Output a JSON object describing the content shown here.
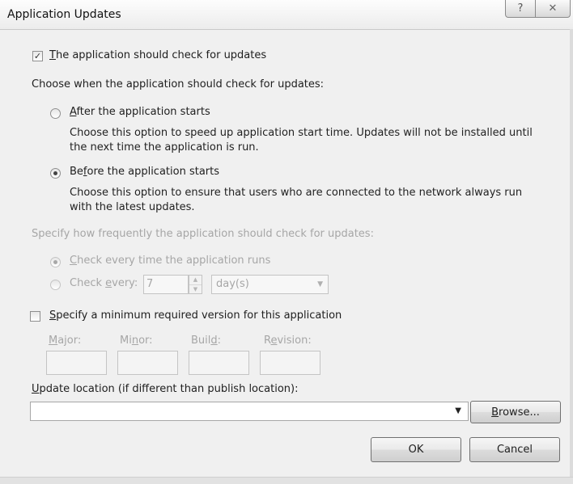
{
  "window": {
    "title": "Application Updates",
    "help_glyph": "?",
    "close_glyph": "✕"
  },
  "check_updates": {
    "checked": true,
    "check_glyph": "✓",
    "label_key": "T",
    "label_rest": "he application should check for updates"
  },
  "when": {
    "heading": "Choose when the application should check for updates:",
    "after": {
      "selected": false,
      "label_key": "A",
      "label_rest": "fter the application starts",
      "desc_line1": "Choose this option to speed up application start time. Updates will not be installed until",
      "desc_line2": "the next time the application is run."
    },
    "before": {
      "selected": true,
      "label_pre": "Be",
      "label_key": "f",
      "label_rest": "ore the application starts",
      "desc_line1": "Choose this option to ensure that users who are connected to the network always run",
      "desc_line2": "with the latest updates."
    }
  },
  "frequency": {
    "heading": "Specify how frequently the application should check for updates:",
    "every_time": {
      "selected": true,
      "label_key": "C",
      "label_rest": "heck every time the application runs"
    },
    "every": {
      "selected": false,
      "label_pre": "Check ",
      "label_key": "e",
      "label_rest": "very:",
      "value": "7",
      "unit": "day(s)"
    }
  },
  "min_version": {
    "checked": false,
    "label_key": "S",
    "label_rest": "pecify a minimum required version for this application",
    "fields": [
      {
        "pre": "",
        "key": "M",
        "rest": "ajor:"
      },
      {
        "pre": "Mi",
        "key": "n",
        "rest": "or:"
      },
      {
        "pre": "Buil",
        "key": "d",
        "rest": ":"
      },
      {
        "pre": "R",
        "key": "e",
        "rest": "vision:"
      }
    ]
  },
  "update_location": {
    "label_key": "U",
    "label_rest": "pdate location (if different than publish location):",
    "value": ""
  },
  "buttons": {
    "browse_key": "B",
    "browse_rest": "rowse...",
    "ok": "OK",
    "cancel": "Cancel"
  }
}
